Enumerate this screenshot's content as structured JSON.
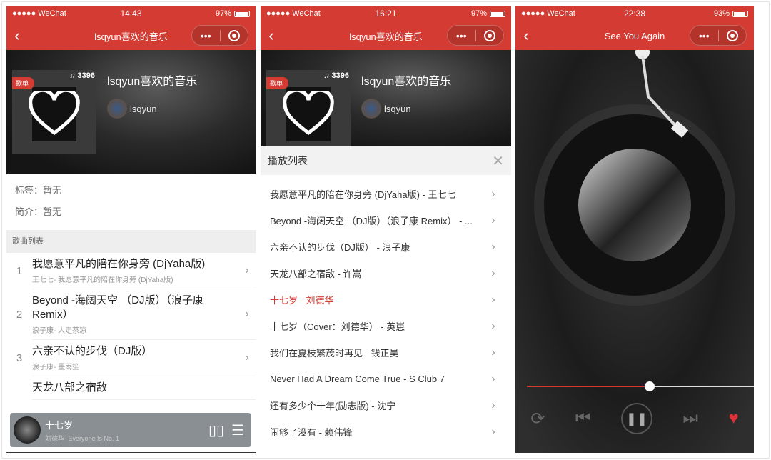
{
  "colors": {
    "brand": "#d43c33",
    "active_song": "#d43c33"
  },
  "screen1": {
    "status": {
      "carrier": "●●●●● WeChat",
      "time": "14:43",
      "battery": "97%"
    },
    "nav": {
      "back_icon": "chevron-left-icon",
      "title": "lsqyun喜欢的音乐",
      "more": "•••"
    },
    "playlist": {
      "badge": "歌单",
      "play_count": "♫ 3396",
      "title": "lsqyun喜欢的音乐",
      "creator": "lsqyun"
    },
    "tags": "标签：暂无",
    "intro": "简介：暂无",
    "section_title": "歌曲列表",
    "songs": [
      {
        "num": "1",
        "name": "我愿意平凡的陪在你身旁 (DjYaha版)",
        "sub": "王七七- 我愿意平凡的陪在你身旁 (DjYaha版)"
      },
      {
        "num": "2",
        "name": "Beyond -海阔天空 （DJ版）（浪子康 Remix）",
        "sub": "浪子康- 人走茶凉"
      },
      {
        "num": "3",
        "name": "六亲不认的步伐（DJ版）",
        "sub": "浪子康- 墨雨笙"
      },
      {
        "num": "",
        "name": "天龙八部之宿敌",
        "sub": ""
      }
    ],
    "mini_player": {
      "title": "十七岁",
      "subtitle": "刘德华- Everyone Is No. 1"
    }
  },
  "screen2": {
    "status": {
      "carrier": "●●●●● WeChat",
      "time": "16:21",
      "battery": "97%"
    },
    "nav": {
      "title": "lsqyun喜欢的音乐",
      "more": "•••"
    },
    "playlist": {
      "play_count": "♫ 3396",
      "title": "lsqyun喜欢的音乐",
      "creator": "lsqyun"
    },
    "panel_title": "播放列表",
    "close": "✕",
    "items": [
      "我愿意平凡的陪在你身旁 (DjYaha版) - 王七七",
      "Beyond -海阔天空 （DJ版）（浪子康 Remix） - ...",
      "六亲不认的步伐（DJ版） - 浪子康",
      "天龙八部之宿敌 - 许嵩",
      "十七岁 - 刘德华",
      "十七岁（Cover：刘德华） - 英崽",
      "我们在夏枝繁茂时再见 - 钱正昊",
      "Never Had A Dream Come True - S Club 7",
      "还有多少个十年(励志版) - 沈宁",
      "闹够了没有 - 赖伟锋"
    ],
    "active_index": 4
  },
  "screen3": {
    "status": {
      "carrier": "●●●●● WeChat",
      "time": "22:38",
      "battery": "93%"
    },
    "nav": {
      "title": "See You Again",
      "more": "•••"
    },
    "progress_percent": 54,
    "liked": true
  }
}
